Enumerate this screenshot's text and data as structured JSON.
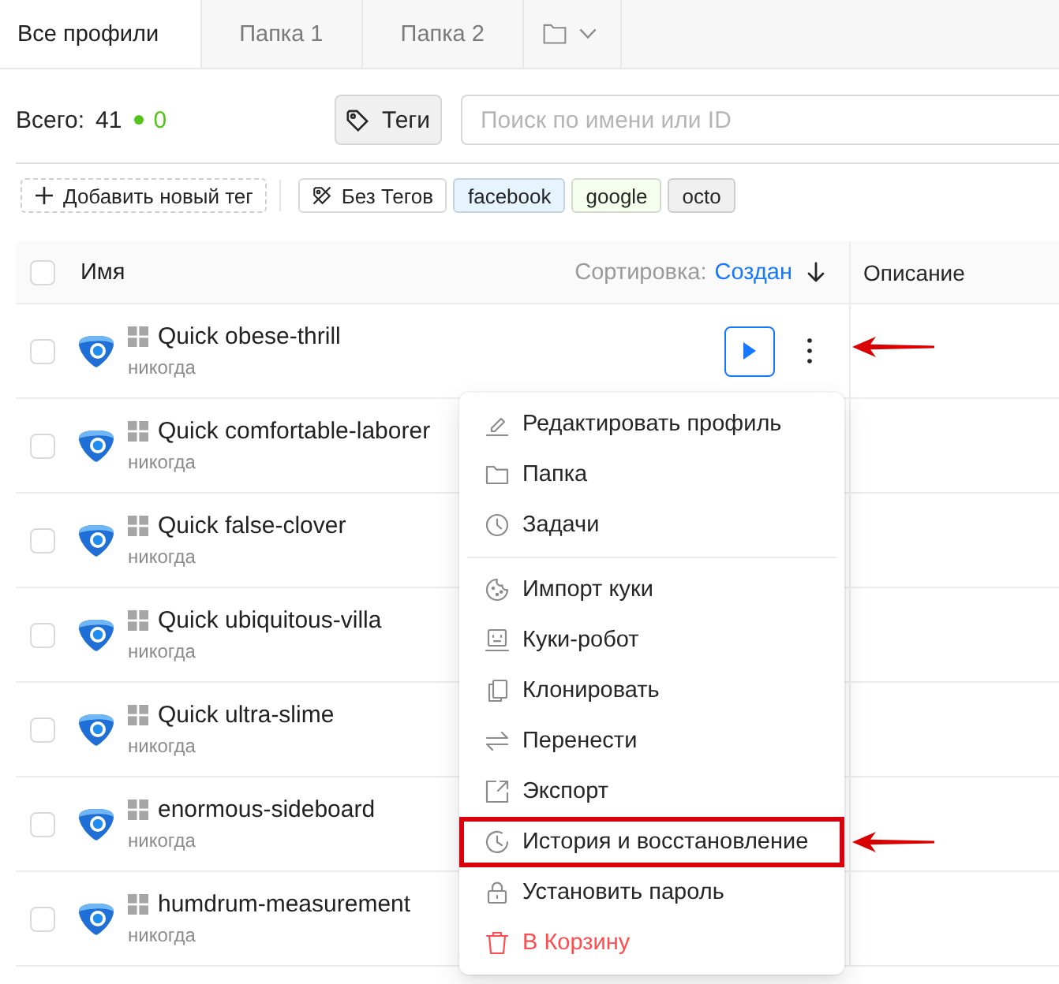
{
  "tabs": [
    {
      "kind": "text",
      "label": "Все профили",
      "selected": true
    },
    {
      "kind": "text",
      "label": "Папка 1",
      "selected": false
    },
    {
      "kind": "text",
      "label": "Папка 2",
      "selected": false
    },
    {
      "kind": "folder-menu",
      "selected": false
    }
  ],
  "summary": {
    "label": "Всего:",
    "total": "41",
    "online": "0"
  },
  "tags_button": {
    "label": "Теги"
  },
  "search": {
    "placeholder": "Поиск по имени или ID"
  },
  "add_tag_button": {
    "label": "Добавить новый тег"
  },
  "tag_filters": [
    {
      "kind": "untagged",
      "label": "Без Тегов"
    },
    {
      "kind": "tag",
      "label": "facebook",
      "color": "#e6f4ff"
    },
    {
      "kind": "tag",
      "label": "google",
      "color": "#f6ffed"
    },
    {
      "kind": "tag",
      "label": "octo",
      "color": "#f0f0f0"
    }
  ],
  "table": {
    "select_all": {
      "checked": false
    },
    "columns": [
      {
        "label": "Имя"
      },
      {
        "label": "Описание"
      }
    ],
    "sort": {
      "label": "Сортировка:",
      "value": "Создан"
    },
    "rows": [
      {
        "name": "Quick obese-thrill",
        "last_run": "никогда",
        "checked": false,
        "actions": {
          "menu_highlighted": true
        }
      },
      {
        "name": "Quick comfortable-laborer",
        "last_run": "никогда",
        "checked": false
      },
      {
        "name": "Quick false-clover",
        "last_run": "никогда",
        "checked": false
      },
      {
        "name": "Quick ubiquitous-villa",
        "last_run": "никогда",
        "checked": false
      },
      {
        "name": "Quick ultra-slime",
        "last_run": "никогда",
        "checked": false
      },
      {
        "name": "enormous-sideboard",
        "last_run": "никогда",
        "checked": false
      },
      {
        "name": "humdrum-measurement",
        "last_run": "никогда",
        "checked": false
      }
    ]
  },
  "context_menu": {
    "groups": [
      {
        "items": [
          {
            "kind": "edit",
            "label": "Редактировать профиль",
            "danger": false,
            "highlighted": false
          },
          {
            "kind": "folder",
            "label": "Папка",
            "danger": false,
            "highlighted": false
          },
          {
            "kind": "tasks",
            "label": "Задачи",
            "danger": false,
            "highlighted": false
          }
        ]
      },
      {
        "items": [
          {
            "kind": "cookie",
            "label": "Импорт куки",
            "danger": false,
            "highlighted": false
          },
          {
            "kind": "robot",
            "label": "Куки-робот",
            "danger": false,
            "highlighted": false
          },
          {
            "kind": "clone",
            "label": "Клонировать",
            "danger": false,
            "highlighted": false
          },
          {
            "kind": "transfer",
            "label": "Перенести",
            "danger": false,
            "highlighted": false
          },
          {
            "kind": "export",
            "label": "Экспорт",
            "danger": false,
            "highlighted": false
          },
          {
            "kind": "history",
            "label": "История и восстановление",
            "danger": false,
            "highlighted": true
          },
          {
            "kind": "password",
            "label": "Установить пароль",
            "danger": false,
            "highlighted": false
          },
          {
            "kind": "delete",
            "label": "В Корзину",
            "danger": true,
            "highlighted": false
          }
        ]
      }
    ]
  }
}
